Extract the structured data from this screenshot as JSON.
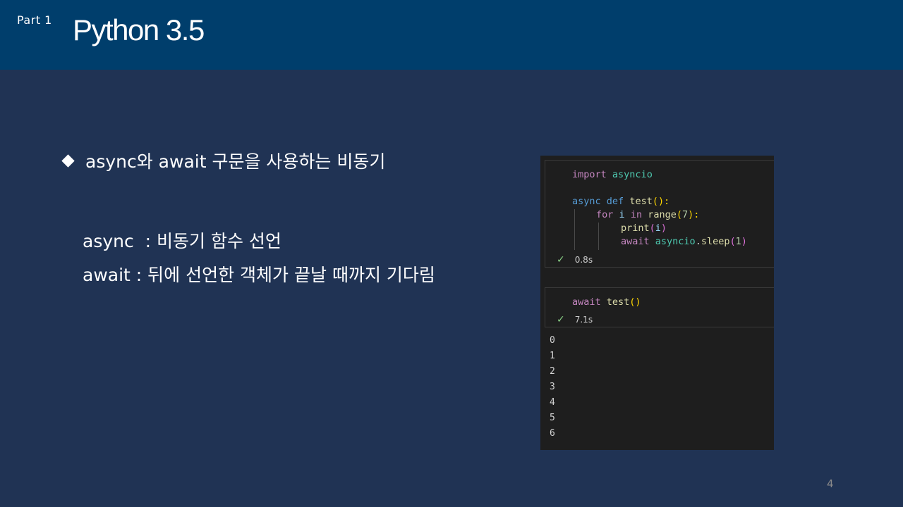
{
  "header": {
    "part_label": "Part 1",
    "title": "Python 3.5"
  },
  "content": {
    "bullet": "async와 await 구문을 사용하는 비동기",
    "definitions": [
      "async  : 비동기 함수 선언",
      "await : 뒤에 선언한 객체가 끝날 때까지 기다림"
    ]
  },
  "notebook": {
    "cell1": {
      "line1": {
        "kw": "import",
        "mod": "asyncio"
      },
      "line2": {
        "kw1": "async",
        "kw2": "def",
        "fn": "test",
        "paren": "():"
      },
      "line3": {
        "kw1": "for",
        "var": "i",
        "kw2": "in",
        "fn": "range",
        "open": "(",
        "num": "7",
        "close": "):"
      },
      "line4": {
        "fn": "print",
        "open": "(",
        "var": "i",
        "close": ")"
      },
      "line5": {
        "kw": "await",
        "mod": "asyncio",
        "dot": ".",
        "fn": "sleep",
        "open": "(",
        "num": "1",
        "close": ")"
      },
      "status_time": "0.8s"
    },
    "cell2": {
      "line1": {
        "kw": "await",
        "fn": "test",
        "paren": "()"
      },
      "status_time": "7.1s"
    },
    "output": [
      "0",
      "1",
      "2",
      "3",
      "4",
      "5",
      "6"
    ]
  },
  "page_number": "4",
  "colors": {
    "header_bg": "#003e6c",
    "body_bg": "#203354",
    "notebook_bg": "#1e1e1e",
    "check_green": "#89d185"
  }
}
